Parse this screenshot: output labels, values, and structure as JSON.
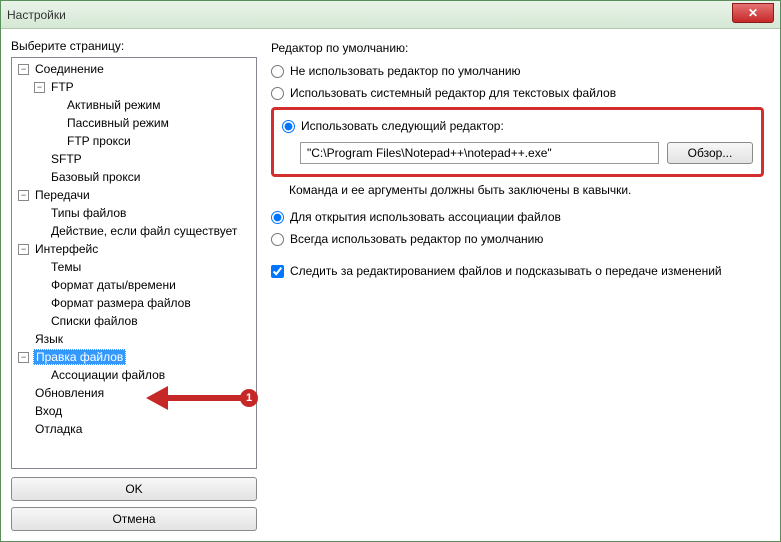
{
  "window": {
    "title": "Настройки"
  },
  "left": {
    "label": "Выберите страницу:",
    "tree": {
      "connection": "Соединение",
      "ftp": "FTP",
      "active": "Активный режим",
      "passive": "Пассивный режим",
      "ftpproxy": "FTP прокси",
      "sftp": "SFTP",
      "basicproxy": "Базовый прокси",
      "transfers": "Передачи",
      "filetypes": "Типы файлов",
      "fileexists": "Действие, если файл существует",
      "interface": "Интерфейс",
      "themes": "Темы",
      "datefmt": "Формат даты/времени",
      "sizefmt": "Формат размера файлов",
      "filelists": "Списки файлов",
      "language": "Язык",
      "editfiles": "Правка файлов",
      "assoc": "Ассоциации файлов",
      "updates": "Обновления",
      "login": "Вход",
      "debug": "Отладка"
    },
    "ok": "OK",
    "cancel": "Отмена"
  },
  "right": {
    "group": "Редактор по умолчанию:",
    "r1": "Не использовать редактор по умолчанию",
    "r2": "Использовать системный редактор для текстовых файлов",
    "r3": "Использовать следующий редактор:",
    "path": "\"C:\\Program Files\\Notepad++\\notepad++.exe\"",
    "browse": "Обзор...",
    "hint": "Команда и ее аргументы должны быть заключены в кавычки.",
    "r4": "Для открытия использовать ассоциации файлов",
    "r5": "Всегда использовать редактор по умолчанию",
    "chk": "Следить за редактированием файлов и подсказывать о передаче изменений"
  },
  "annotation": {
    "badge": "1"
  }
}
